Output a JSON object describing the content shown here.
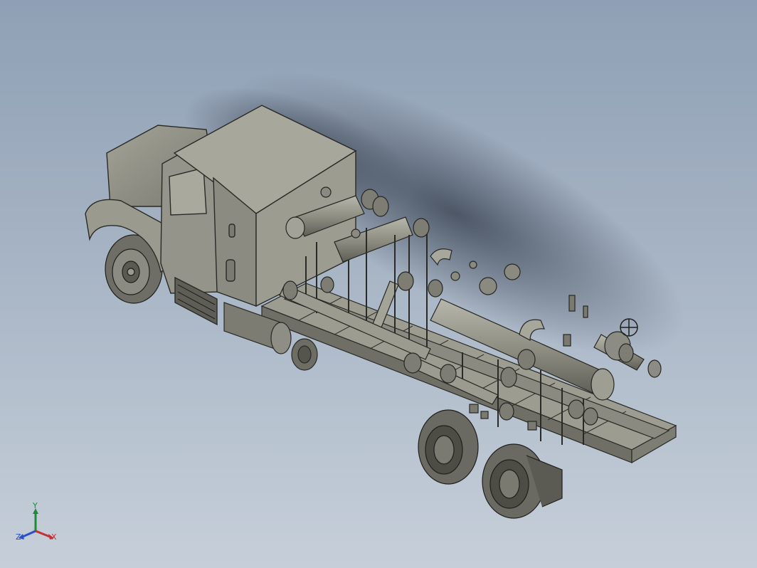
{
  "viewport": {
    "background_top": "#8fa0b5",
    "background_bottom": "#c6cfd9",
    "model_color": "#8f8f86",
    "edge_color": "#2a2a27"
  },
  "model": {
    "name_icon": "truck-mounted-manifold-skid"
  },
  "triad": {
    "x_label": "X",
    "y_label": "Y",
    "z_label": "Z",
    "x_color": "#c23232",
    "y_color": "#1f8a3a",
    "z_color": "#2b4fc4"
  }
}
